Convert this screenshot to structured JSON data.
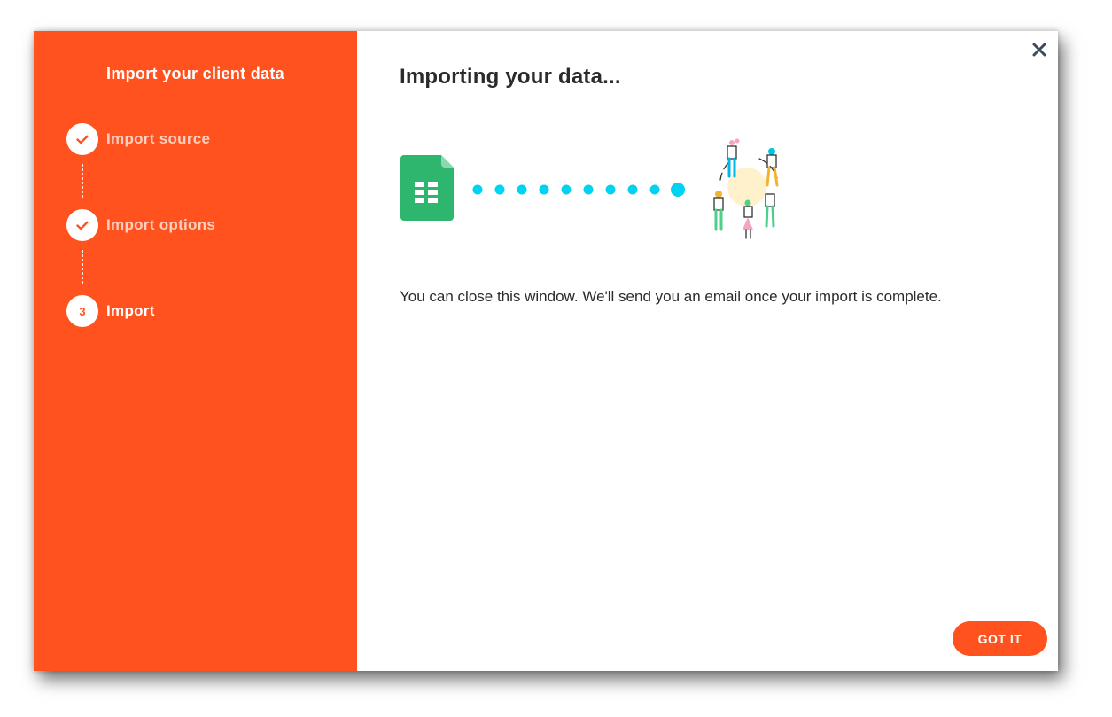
{
  "sidebar": {
    "title": "Import your client data",
    "steps": [
      {
        "label": "Import source",
        "state": "done"
      },
      {
        "label": "Import options",
        "state": "done"
      },
      {
        "label": "Import",
        "state": "active",
        "number": "3"
      }
    ]
  },
  "main": {
    "title": "Importing your data...",
    "message": "You can close this window. We'll send you an email once your import is complete.",
    "got_it_label": "GOT IT"
  },
  "colors": {
    "accent": "#FF521E",
    "progress_dots": "#00D2F2",
    "sheet_icon": "#2FB66E"
  },
  "icons": {
    "close": "close-icon",
    "check": "check-icon",
    "source_file": "google-sheets-icon",
    "destination": "people-illustration"
  }
}
